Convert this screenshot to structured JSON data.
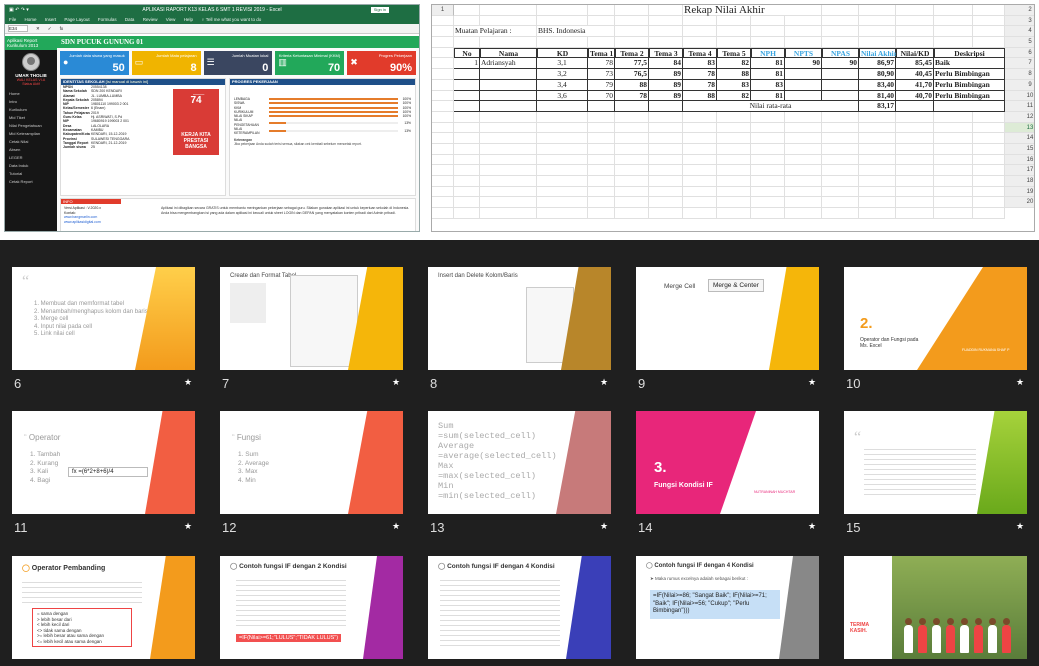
{
  "excel": {
    "window_title": "APLIKASI RAPORT K13 KELAS 6 SMT 1 REVISI 2019 - Excel",
    "signin": "Sign in",
    "menu": [
      "File",
      "Home",
      "Insert",
      "Page Layout",
      "Formulas",
      "Data",
      "Review",
      "View",
      "Help",
      "♀ Tell me what you want to do"
    ],
    "namebox": "E34",
    "fx": "fx",
    "sidebar": {
      "title": "Aplikasi Report Kurikulum 2013",
      "user_name": "UMAR THOLIB",
      "user_sub": "WALI KELAS VI-A",
      "status": "Status Aktif",
      "items": [
        "Home",
        "Intro",
        "Kurikulum",
        "Mid Tiket",
        "Nilai Pengetahuan",
        "Mid Keterampilan",
        "Cetak Nilai",
        "Absen",
        "LEGER",
        "Data Induk",
        "Tutorial",
        "Cetak Report"
      ]
    },
    "school_title": "SDN PUCUK GUNUNG 01",
    "cards": [
      {
        "label": "Jumlah data siswa yang masuk",
        "value": "50"
      },
      {
        "label": "Jumlah Mata pelajaran",
        "value": "8"
      },
      {
        "label": "Jumlah Muatan lokal",
        "value": "0"
      },
      {
        "label": "Kriteria Ketuntasan Minimal (KKM)",
        "value": "70"
      },
      {
        "label": "Progres Pekerjaan",
        "value": "90%"
      }
    ],
    "identity_title": "IDENTITAS SEKOLAH",
    "identity_sub": "[Isi manual di kawah ini]",
    "identity": [
      [
        "NPSN",
        "20554138"
      ],
      [
        "Nama Sekolah",
        "SDN 200 KENDARI"
      ],
      [
        "Alamat",
        "JL. LUMBA-LUMBA"
      ],
      [
        "Kepala Sekolah",
        "205894"
      ],
      [
        "NIP",
        "19801110 199003 2 001"
      ],
      [
        "Kelas/Semester",
        "6 (Enam)"
      ],
      [
        "Tahun Pelajaran",
        "2019"
      ],
      [
        "Guru Kelas",
        "Hj. ASRIWATI, S.Pd"
      ],
      [
        "NIP",
        "19680919 199003 2 001"
      ],
      [
        "Desa",
        "LALOLARA"
      ],
      [
        "Kecamatan",
        "KAMBU"
      ],
      [
        "Kabupaten/Kota",
        "KENDARI, 15-12-2019"
      ],
      [
        "Provinsi",
        "SULAWESI TENGGARA"
      ],
      [
        "Tanggal Report",
        "KENDARI, 21-12-2019"
      ],
      [
        "Jumlah siswa",
        "25"
      ]
    ],
    "poster_text": "KERJA KITA PRESTASI BANGSA",
    "progress_title": "PROGRES PEKERJAAN",
    "progress": [
      {
        "label": "LEMBAGA",
        "pct": "100%",
        "v": 1.0
      },
      {
        "label": "SISWA",
        "pct": "100%",
        "v": 1.0
      },
      {
        "label": "KKM",
        "pct": "100%",
        "v": 1.0
      },
      {
        "label": "KURIKULUM",
        "pct": "100%",
        "v": 1.0
      },
      {
        "label": "NILAI SIKAP",
        "pct": "100%",
        "v": 1.0
      },
      {
        "label": "NILAI PENGETAHUAN",
        "pct": "13%",
        "v": 0.13
      },
      {
        "label": "NILAI KETERAMPILAN",
        "pct": "13%",
        "v": 0.13
      }
    ],
    "ket_title": "Keterangan",
    "ket_text": "Jika pekerjaan Anda sudah terisi semua, silakan cek kembali sebelum mencetak report.",
    "info_title": "INFO",
    "info_left": [
      "Versi Aplikasi : V.2020.x",
      "Kontak:",
      "www.bangmarlin.com",
      "www.aplikasidigital.com"
    ],
    "info_text": "Aplikasi ini dibagikan secara GRATIS untuk membantu meringankan pekerjaan sebagai guru. Silakan gunakan aplikasi ini untuk keperluan sekolah di Indonesia. Anda bisa mengembangkan isi yang ada dalam aplikasi ini kecuali untuk sheet LOGIN dan DEPAN yang menyatakan konten pribadi dari Admin pribadi."
  },
  "rekap": {
    "title": "Rekap Nilai Akhir",
    "mapel_label": "Muatan Pelajaran :",
    "mapel_value": "BHS. Indonesia",
    "headers": [
      "No",
      "Nama",
      "KD",
      "Tema 1",
      "Tema 2",
      "Tema 3",
      "Tema 4",
      "Tema 5",
      "NPH",
      "NPTS",
      "NPAS",
      "Nilai Akhir",
      "Nilai/KD",
      "Deskripsi"
    ],
    "rows": [
      [
        "1",
        "Adriansyah",
        "3,1",
        "78",
        "77,5",
        "84",
        "83",
        "82",
        "81",
        "90",
        "90",
        "86,97",
        "85,45",
        "Baik"
      ],
      [
        "",
        "",
        "3,2",
        "73",
        "76,5",
        "89",
        "78",
        "88",
        "81",
        "",
        "",
        "80,90",
        "40,45",
        "Perlu Bimbingan"
      ],
      [
        "",
        "",
        "3,4",
        "79",
        "88",
        "89",
        "78",
        "83",
        "83",
        "",
        "",
        "83,40",
        "41,70",
        "Perlu Bimbingan"
      ],
      [
        "",
        "",
        "3,6",
        "70",
        "78",
        "89",
        "88",
        "82",
        "81",
        "",
        "",
        "81,40",
        "40,70",
        "Perlu Bimbingan"
      ]
    ],
    "avg_label": "Nilai rata-rata",
    "avg_value": "83,17"
  },
  "slides": [
    {
      "n": "6",
      "lines": [
        "1. Membuat dan memformat tabel",
        "2. Menambah/menghapus kolom dan baris",
        "3. Merge cell",
        "4. Input nilai pada cell",
        "5. Link nilai cell"
      ]
    },
    {
      "n": "7",
      "title": "Create dan Format Tabel"
    },
    {
      "n": "8",
      "title": "Insert dan Delete Kolom/Baris"
    },
    {
      "n": "9",
      "title": "Merge Cell",
      "btn": "Merge & Center"
    },
    {
      "n": "10",
      "big": "2.",
      "sub": "Operator dan Fungsi pada Ms. Excel",
      "author": "FUADDIN RUKMANA SHAF P"
    },
    {
      "n": "11",
      "title": "Operator",
      "lines": [
        "1. Tambah",
        "2. Kurang",
        "3. Kali",
        "4. Bagi"
      ],
      "formula": "=(6*2+8+6)/4"
    },
    {
      "n": "12",
      "title": "Fungsi",
      "lines": [
        "1. Sum",
        "2. Average",
        "3. Max",
        "4. Min"
      ]
    },
    {
      "n": "13",
      "lines": [
        "Sum",
        "=sum(selected_cell)",
        "Average",
        "=average(selected_cell)",
        "Max",
        "=max(selected_cell)",
        "Min",
        "=min(selected_cell)"
      ]
    },
    {
      "n": "14",
      "big": "3.",
      "sub": "Fungsi Kondisi IF",
      "author": "NUTRANINAH MUCHTAR"
    },
    {
      "n": "15"
    },
    {
      "n": "16",
      "title": "Operator Pembanding",
      "ops": [
        "= sama dengan",
        "> lebih besar dari",
        "< lebih kecil dari",
        "<> tidak sama dengan",
        ">= lebih besar atau sama dengan",
        "<= lebih kecil atau sama dengan"
      ]
    },
    {
      "n": "17",
      "title": "Contoh fungsi IF dengan 2 Kondisi",
      "formula": "=IF(Nilai>=61;\"LULUS\";\"TIDAK LULUS\")"
    },
    {
      "n": "18",
      "title": "Contoh fungsi IF dengan 4 Kondisi"
    },
    {
      "n": "19",
      "title": "Contoh fungsi IF dengan 4 Kondisi",
      "intro": "Maka rumus excelnya adalah sebagai berikut :",
      "formula": "=IF(Nilai>=86; \"Sangat Baik\"; IF(Nilai>=71; \"Baik\"; IF(Nilai>=56; \"Cukup\"; \"Perlu Bimbingan\")))"
    },
    {
      "n": "20",
      "caption": "TERIMA KASIH."
    }
  ]
}
